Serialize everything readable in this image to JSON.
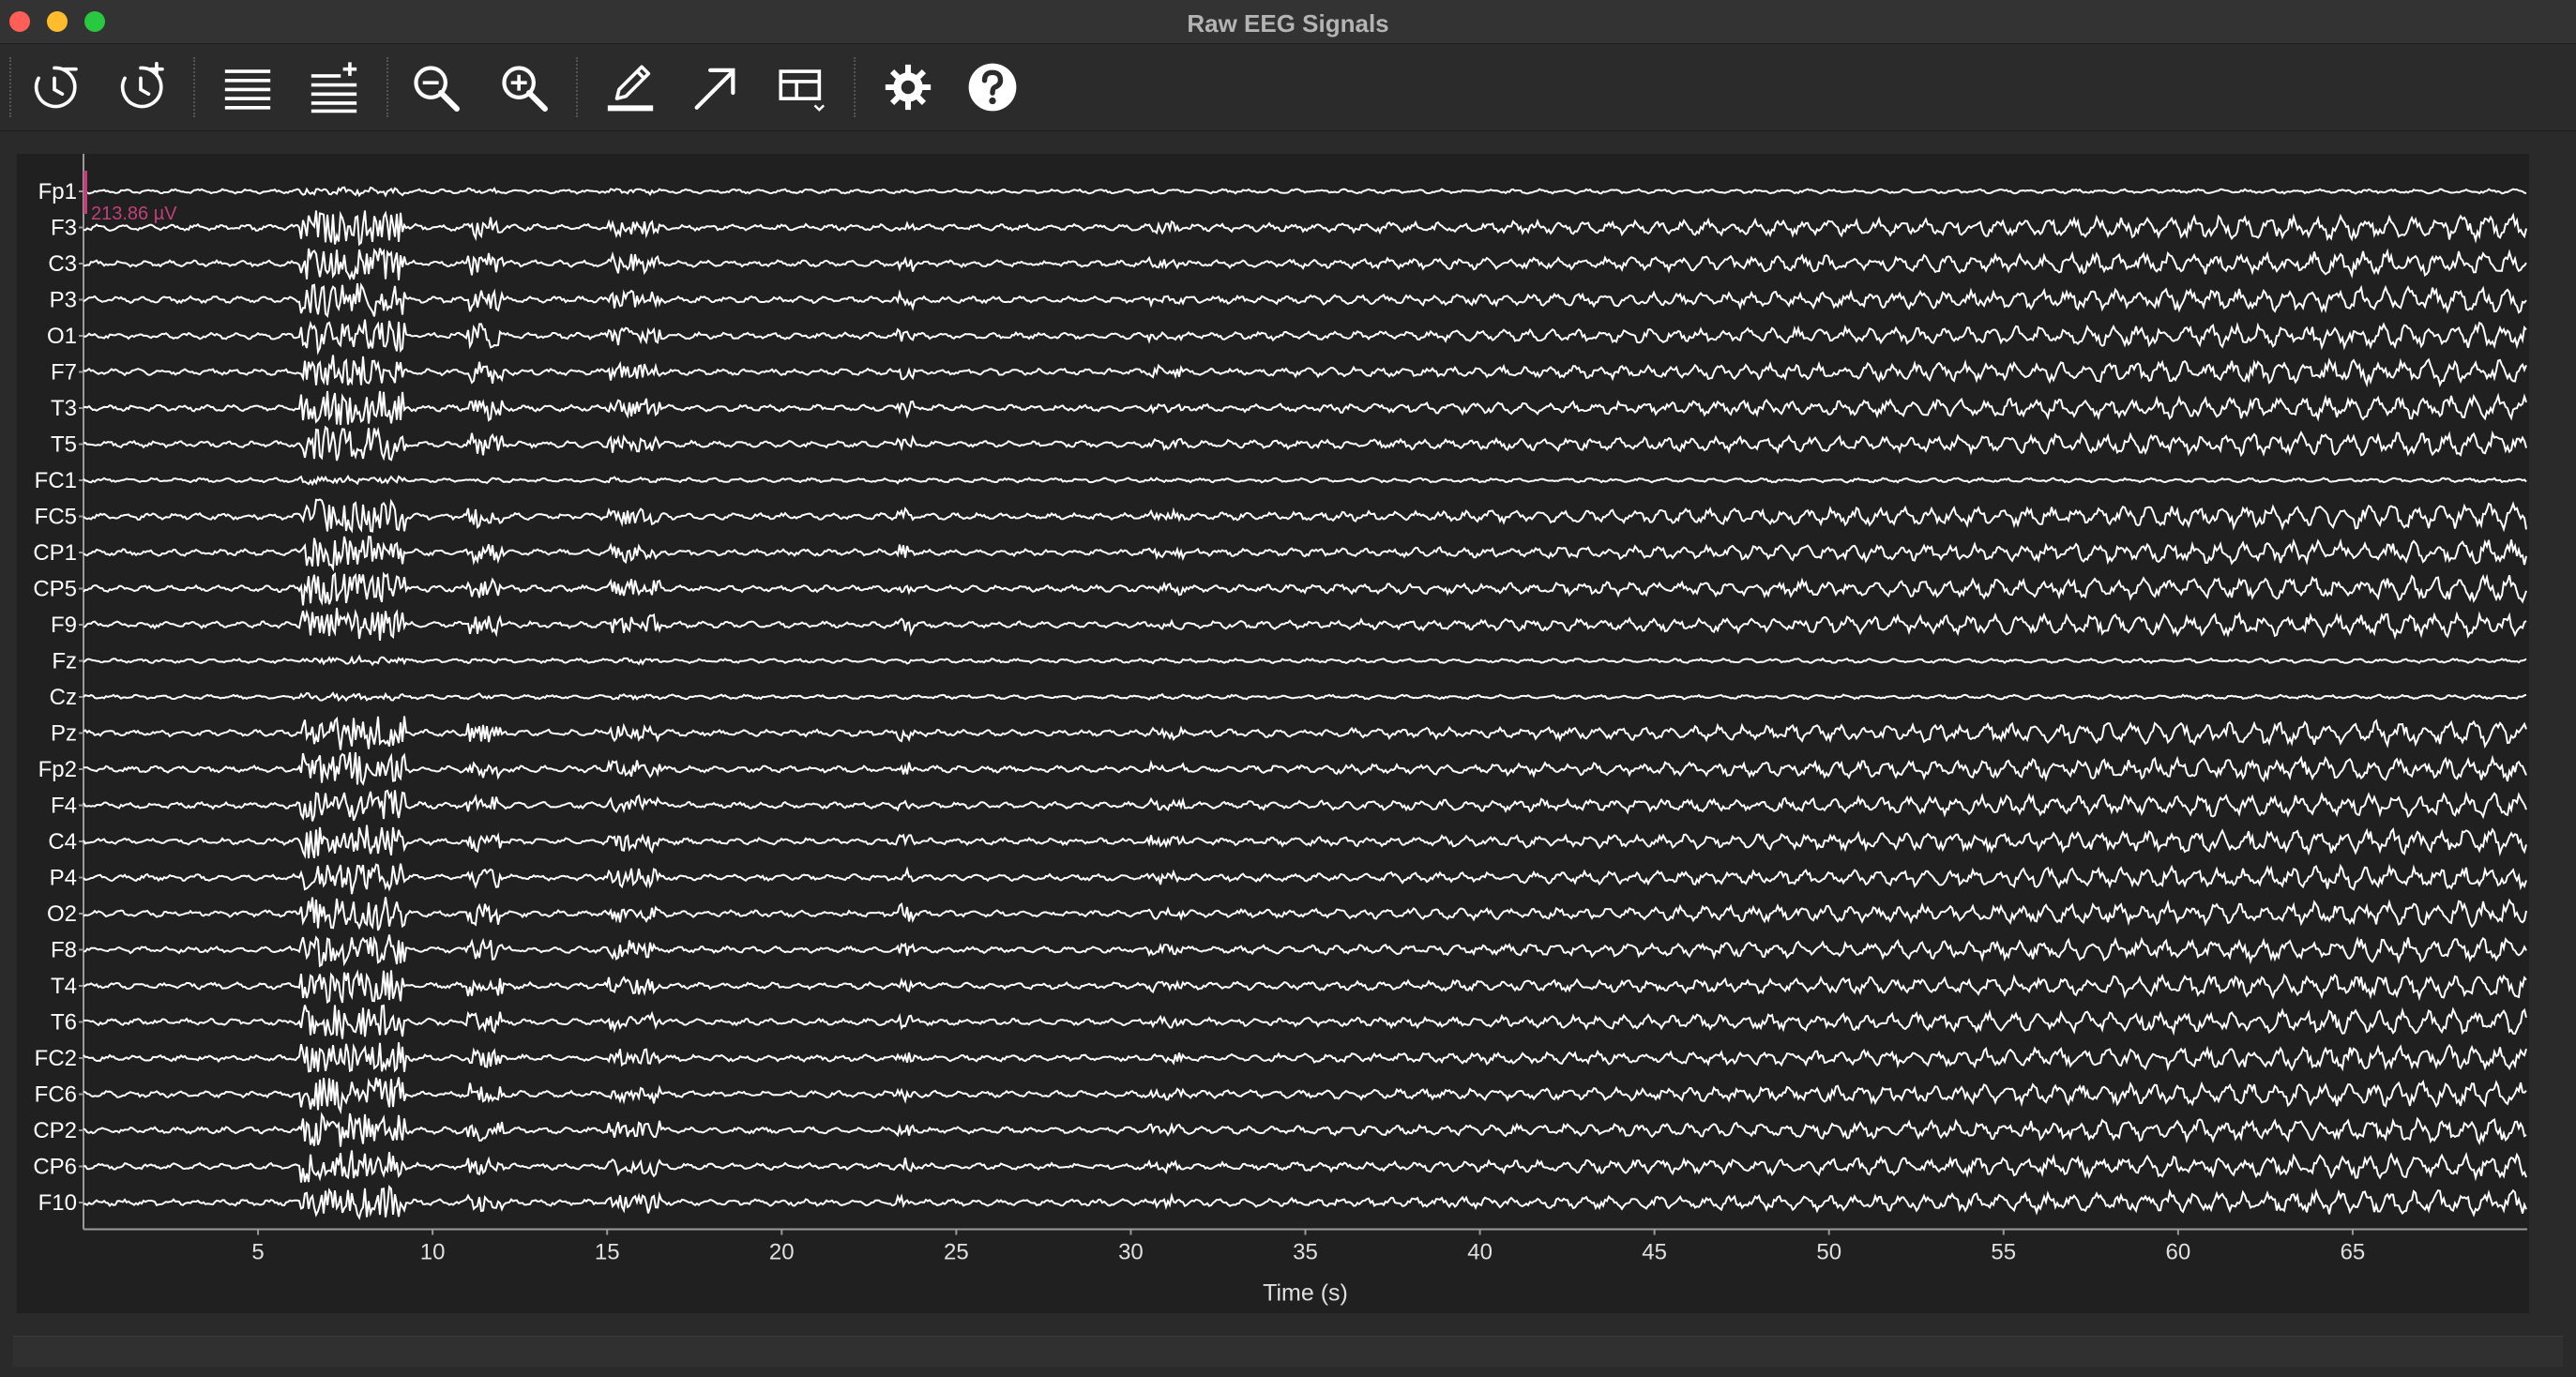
{
  "window": {
    "title": "Raw EEG Signals"
  },
  "toolbar": {
    "buttons": [
      {
        "name": "decrease-time-window",
        "icon": "clock-minus-icon"
      },
      {
        "name": "increase-time-window",
        "icon": "clock-plus-icon"
      },
      {
        "name": "decrease-channels",
        "icon": "list-minus-icon"
      },
      {
        "name": "increase-channels",
        "icon": "list-plus-icon"
      },
      {
        "name": "zoom-out",
        "icon": "zoom-out-icon"
      },
      {
        "name": "zoom-in",
        "icon": "zoom-in-icon"
      },
      {
        "name": "annotate",
        "icon": "pencil-icon"
      },
      {
        "name": "scalebar",
        "icon": "arrow-icon"
      },
      {
        "name": "overview",
        "icon": "grid-layout-icon"
      },
      {
        "name": "settings",
        "icon": "gear-icon"
      },
      {
        "name": "help",
        "icon": "help-icon"
      }
    ]
  },
  "chart_data": {
    "type": "line",
    "title": "",
    "xlabel": "Time (s)",
    "ylabel": "",
    "xlim": [
      0,
      70
    ],
    "xticks": [
      5,
      10,
      15,
      20,
      25,
      30,
      35,
      40,
      45,
      50,
      55,
      60,
      65
    ],
    "channels": [
      "Fp1",
      "F3",
      "C3",
      "P3",
      "O1",
      "F7",
      "T3",
      "T5",
      "FC1",
      "FC5",
      "CP1",
      "CP5",
      "F9",
      "Fz",
      "Cz",
      "Pz",
      "Fp2",
      "F4",
      "C4",
      "P4",
      "O2",
      "F8",
      "T4",
      "T6",
      "FC2",
      "FC6",
      "CP2",
      "CP6",
      "F10"
    ],
    "scalebar": {
      "label": "213.86 µV",
      "color": "#c0407a"
    },
    "trace_color": "#ffffff",
    "background": "#202020",
    "grid": false
  }
}
